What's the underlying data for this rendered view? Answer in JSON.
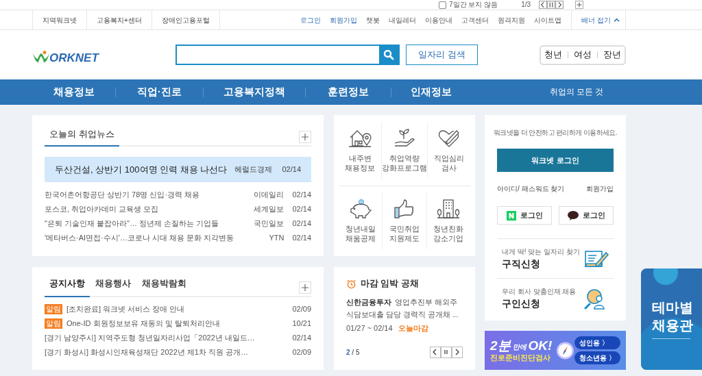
{
  "top_banner_strip": {
    "hide_label": "7일간 보지 않음",
    "hide_checked": false,
    "pager": "1/3"
  },
  "utility_bar": {
    "left_links": [
      "지역워크넷",
      "고용복지+센터",
      "장애인고용포털"
    ],
    "right_links": [
      {
        "label": "로그인",
        "highlight": true
      },
      {
        "label": "회원가입",
        "highlight": true
      },
      {
        "label": "챗봇",
        "highlight": false
      },
      {
        "label": "내일레터",
        "highlight": false
      },
      {
        "label": "이용안내",
        "highlight": false
      },
      {
        "label": "고객센터",
        "highlight": false
      },
      {
        "label": "원격지원",
        "highlight": false
      },
      {
        "label": "사이트맵",
        "highlight": false
      }
    ],
    "banner_toggle": "배너 접기"
  },
  "header": {
    "logo": "ORKNET",
    "job_search_button": "일자리 검색",
    "audience_links": [
      "청년",
      "여성",
      "장년"
    ]
  },
  "main_nav": {
    "items": [
      "채용정보",
      "직업·진로",
      "고용복지정책",
      "훈련정보",
      "인재정보"
    ],
    "all_link": "취업의 모든 것"
  },
  "news_card": {
    "tab": "오늘의 취업뉴스",
    "headline": {
      "title": "두산건설, 상반기 100여명 인력 채용 나선다",
      "source": "헤럴드경제",
      "date": "02/14"
    },
    "items": [
      {
        "title": "한국어촌어항공단 상반기 78명 신입·경력 채용",
        "source": "이데일리",
        "date": "02/14"
      },
      {
        "title": "포스코, 취업아카데미 교육생 모집",
        "source": "세계일보",
        "date": "02/14"
      },
      {
        "title": "\"은퇴 기술인재 붙잡아라\"… 정년제 손질하는 기업들",
        "source": "국민일보",
        "date": "02/14"
      },
      {
        "title": "'메타버스·AI면접·수시'…코로나 시대 채용 문화 지각변동",
        "source": "YTN",
        "date": "02/14"
      }
    ]
  },
  "quick_menu": [
    {
      "kind": "house",
      "lines": [
        "내주변",
        "채용정보"
      ]
    },
    {
      "kind": "sprout",
      "lines": [
        "취업역량",
        "강화프로그램"
      ]
    },
    {
      "kind": "heart",
      "lines": [
        "직업심리",
        "검사"
      ]
    },
    {
      "kind": "piggy",
      "lines": [
        "청년내일",
        "채움공제"
      ]
    },
    {
      "kind": "thumb",
      "lines": [
        "국민취업",
        "지원제도"
      ]
    },
    {
      "kind": "building",
      "lines": [
        "청년친화",
        "강소기업"
      ]
    }
  ],
  "login_card": {
    "notice": "워크넷을 더 안전하고 편리하게 이용하세요.",
    "login_button": "워크넷 로그인",
    "find_account": "아이디/ 패스워드 찾기",
    "join": "회원가입",
    "social": [
      {
        "kind": "naver",
        "label": "로그인"
      },
      {
        "kind": "kakao",
        "label": "로그인"
      }
    ],
    "services": [
      {
        "kind": "seeker",
        "caption": "내게 딱! 맞는 일자리 찾기",
        "title": "구직신청"
      },
      {
        "kind": "employer",
        "caption": "우리 회사 맞춤인재 채용",
        "title": "구인신청"
      }
    ]
  },
  "notice_card": {
    "tabs": [
      {
        "label": "공지사항",
        "selected": true
      },
      {
        "label": "채용행사",
        "selected": false
      },
      {
        "label": "채용박람회",
        "selected": false
      }
    ],
    "items": [
      {
        "badge": "알림",
        "title": "[조치완료] 워크넷 서비스 장애 안내",
        "date": "02/09"
      },
      {
        "badge": "알림",
        "title": "One-ID 회원정보보유 재동의 및 탈퇴처리안내",
        "date": "10/21"
      },
      {
        "title": "[경기 남양주시] 지역주도형 청년일자리사업「2022년 내일드…",
        "date": "02/14"
      },
      {
        "title": "[경기 화성시] 화성시인재육성재단 2022년 제1차 직원 공개…",
        "date": "02/09"
      }
    ]
  },
  "deadline_card": {
    "title": "마감 임박 공채",
    "company": "신한금융투자",
    "job": "영업추진부 해외주식담보대출 담당 경력직 공개채 ...",
    "period": "01/27 ~ 02/14",
    "status": "오늘마감",
    "page_current": "2",
    "page_total": "/ 5"
  },
  "ad_banner": {
    "headline_big": "2분",
    "headline_small": "만에",
    "headline_ok": "OK!",
    "subtitle": "진로준비진단검사",
    "buttons": [
      "성인용 〉",
      "청소년용 〉"
    ]
  },
  "side_banner": {
    "lines": [
      "테마별",
      "채용관"
    ]
  }
}
